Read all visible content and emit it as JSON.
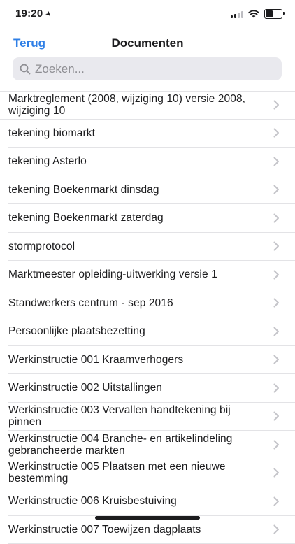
{
  "status": {
    "time": "19:20"
  },
  "nav": {
    "back_label": "Terug",
    "title": "Documenten"
  },
  "search": {
    "placeholder": "Zoeken..."
  },
  "documents": [
    "Marktreglement (2008, wijziging 10)  versie 2008, wijziging 10",
    "tekening biomarkt",
    "tekening Asterlo",
    "tekening Boekenmarkt dinsdag",
    "tekening Boekenmarkt zaterdag",
    "stormprotocol",
    "Marktmeester opleiding-uitwerking  versie 1",
    "Standwerkers centrum - sep 2016",
    "Persoonlijke plaatsbezetting",
    "Werkinstructie 001 Kraamverhogers",
    "Werkinstructie 002 Uitstallingen",
    "Werkinstructie 003 Vervallen handtekening bij pinnen",
    "Werkinstructie 004 Branche- en artikelindeling gebrancheerde markten",
    "Werkinstructie 005 Plaatsen met een nieuwe bestemming",
    "Werkinstructie 006 Kruisbestuiving",
    "Werkinstructie 007 Toewijzen dagplaats"
  ]
}
